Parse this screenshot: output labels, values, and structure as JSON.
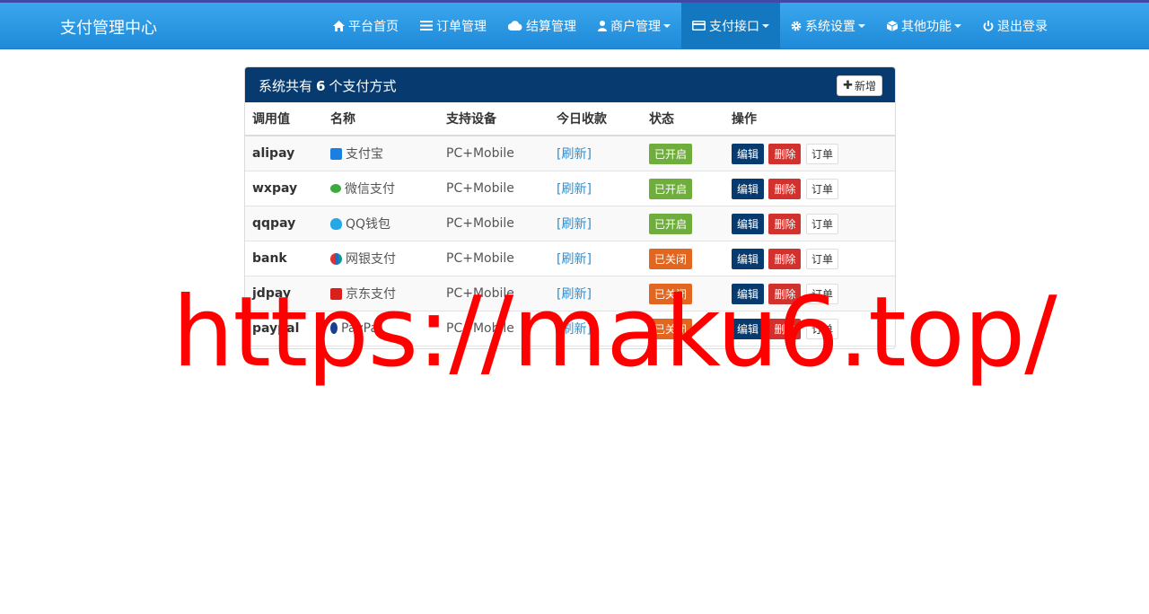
{
  "brand": "支付管理中心",
  "nav": [
    {
      "label": "平台首页",
      "icon": "home-icon"
    },
    {
      "label": "订单管理",
      "icon": "list-icon"
    },
    {
      "label": "结算管理",
      "icon": "cloud-icon"
    },
    {
      "label": "商户管理",
      "icon": "user-icon",
      "dropdown": true
    },
    {
      "label": "支付接口",
      "icon": "credit-card-icon",
      "dropdown": true,
      "active": true
    },
    {
      "label": "系统设置",
      "icon": "gear-icon",
      "dropdown": true
    },
    {
      "label": "其他功能",
      "icon": "cube-icon",
      "dropdown": true
    },
    {
      "label": "退出登录",
      "icon": "power-icon"
    }
  ],
  "panel": {
    "title_prefix": "系统共有",
    "count": "6",
    "title_suffix": "个支付方式",
    "add_label": "新增"
  },
  "table": {
    "headers": [
      "调用值",
      "名称",
      "支持设备",
      "今日收款",
      "状态",
      "操作"
    ],
    "rows": [
      {
        "code": "alipay",
        "name": "支付宝",
        "icon": "alipay-icon",
        "device": "PC+Mobile",
        "today": "[刷新]",
        "status": "已开启",
        "enabled": true
      },
      {
        "code": "wxpay",
        "name": "微信支付",
        "icon": "wechat-pay-icon",
        "device": "PC+Mobile",
        "today": "[刷新]",
        "status": "已开启",
        "enabled": true
      },
      {
        "code": "qqpay",
        "name": "QQ钱包",
        "icon": "qq-wallet-icon",
        "device": "PC+Mobile",
        "today": "[刷新]",
        "status": "已开启",
        "enabled": true
      },
      {
        "code": "bank",
        "name": "网银支付",
        "icon": "unionpay-icon",
        "device": "PC+Mobile",
        "today": "[刷新]",
        "status": "已关闭",
        "enabled": false
      },
      {
        "code": "jdpay",
        "name": "京东支付",
        "icon": "jd-pay-icon",
        "device": "PC+Mobile",
        "today": "[刷新]",
        "status": "已关闭",
        "enabled": false
      },
      {
        "code": "paypal",
        "name": "PayPal",
        "icon": "paypal-icon",
        "device": "PC+Mobile",
        "today": "[刷新]",
        "status": "已关闭",
        "enabled": false
      }
    ],
    "actions": {
      "edit": "编辑",
      "delete": "删除",
      "orders": "订单"
    }
  },
  "watermark": "https://maku6.top/",
  "colors": {
    "navbar": "#2196e3",
    "panel_heading": "#073b6f",
    "status_on": "#6fae3d",
    "status_off": "#e2661f",
    "delete": "#d2322d",
    "watermark": "#ff0000"
  }
}
